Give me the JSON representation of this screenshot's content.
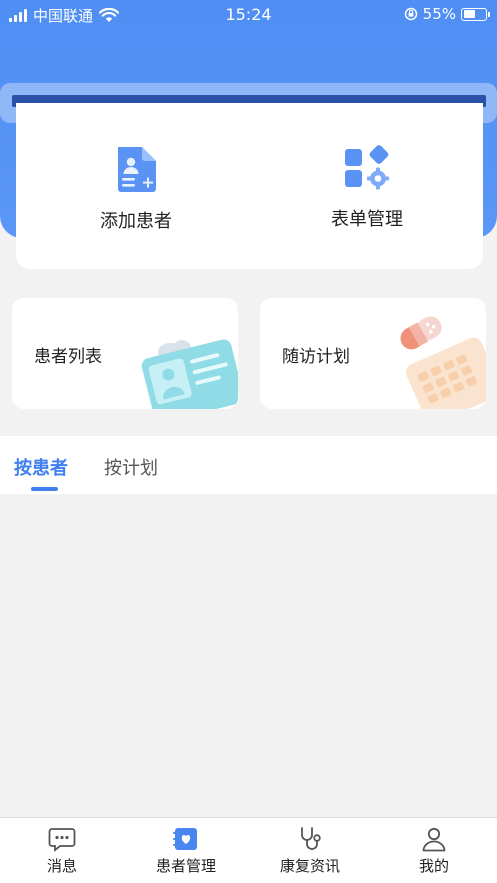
{
  "status_bar": {
    "carrier": "中国联通",
    "time": "15:24",
    "battery": "55%",
    "battery_level": 0.55
  },
  "quick_actions": [
    {
      "label": "添加患者",
      "icon": "add-patient-icon"
    },
    {
      "label": "表单管理",
      "icon": "form-manage-icon"
    }
  ],
  "feature_cards": [
    {
      "label": "患者列表",
      "icon": "patient-id-card-icon"
    },
    {
      "label": "随访计划",
      "icon": "calendar-plan-icon"
    }
  ],
  "tabs": [
    {
      "label": "按患者",
      "active": true
    },
    {
      "label": "按计划",
      "active": false
    }
  ],
  "bottom_nav": [
    {
      "label": "消息",
      "icon": "message-icon"
    },
    {
      "label": "患者管理",
      "icon": "patient-manage-icon",
      "active": true
    },
    {
      "label": "康复资讯",
      "icon": "stethoscope-icon"
    },
    {
      "label": "我的",
      "icon": "user-icon"
    }
  ],
  "colors": {
    "primary": "#4f8ef4",
    "tab_active": "#3f7ff0",
    "background": "#f2f2f2"
  }
}
